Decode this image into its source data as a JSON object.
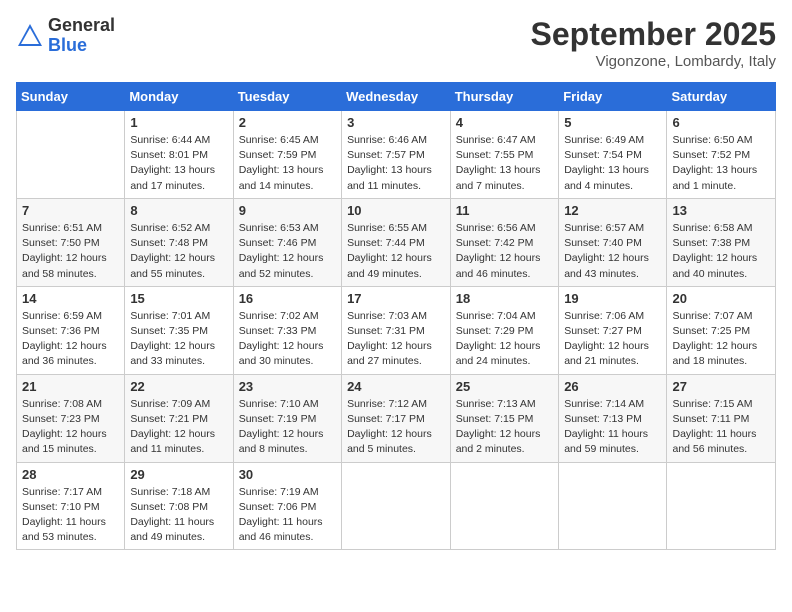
{
  "header": {
    "logo": {
      "general": "General",
      "blue": "Blue"
    },
    "title": "September 2025",
    "subtitle": "Vigonzone, Lombardy, Italy"
  },
  "days_of_week": [
    "Sunday",
    "Monday",
    "Tuesday",
    "Wednesday",
    "Thursday",
    "Friday",
    "Saturday"
  ],
  "weeks": [
    [
      {
        "day": "",
        "sunrise": "",
        "sunset": "",
        "daylight": ""
      },
      {
        "day": "1",
        "sunrise": "Sunrise: 6:44 AM",
        "sunset": "Sunset: 8:01 PM",
        "daylight": "Daylight: 13 hours and 17 minutes."
      },
      {
        "day": "2",
        "sunrise": "Sunrise: 6:45 AM",
        "sunset": "Sunset: 7:59 PM",
        "daylight": "Daylight: 13 hours and 14 minutes."
      },
      {
        "day": "3",
        "sunrise": "Sunrise: 6:46 AM",
        "sunset": "Sunset: 7:57 PM",
        "daylight": "Daylight: 13 hours and 11 minutes."
      },
      {
        "day": "4",
        "sunrise": "Sunrise: 6:47 AM",
        "sunset": "Sunset: 7:55 PM",
        "daylight": "Daylight: 13 hours and 7 minutes."
      },
      {
        "day": "5",
        "sunrise": "Sunrise: 6:49 AM",
        "sunset": "Sunset: 7:54 PM",
        "daylight": "Daylight: 13 hours and 4 minutes."
      },
      {
        "day": "6",
        "sunrise": "Sunrise: 6:50 AM",
        "sunset": "Sunset: 7:52 PM",
        "daylight": "Daylight: 13 hours and 1 minute."
      }
    ],
    [
      {
        "day": "7",
        "sunrise": "Sunrise: 6:51 AM",
        "sunset": "Sunset: 7:50 PM",
        "daylight": "Daylight: 12 hours and 58 minutes."
      },
      {
        "day": "8",
        "sunrise": "Sunrise: 6:52 AM",
        "sunset": "Sunset: 7:48 PM",
        "daylight": "Daylight: 12 hours and 55 minutes."
      },
      {
        "day": "9",
        "sunrise": "Sunrise: 6:53 AM",
        "sunset": "Sunset: 7:46 PM",
        "daylight": "Daylight: 12 hours and 52 minutes."
      },
      {
        "day": "10",
        "sunrise": "Sunrise: 6:55 AM",
        "sunset": "Sunset: 7:44 PM",
        "daylight": "Daylight: 12 hours and 49 minutes."
      },
      {
        "day": "11",
        "sunrise": "Sunrise: 6:56 AM",
        "sunset": "Sunset: 7:42 PM",
        "daylight": "Daylight: 12 hours and 46 minutes."
      },
      {
        "day": "12",
        "sunrise": "Sunrise: 6:57 AM",
        "sunset": "Sunset: 7:40 PM",
        "daylight": "Daylight: 12 hours and 43 minutes."
      },
      {
        "day": "13",
        "sunrise": "Sunrise: 6:58 AM",
        "sunset": "Sunset: 7:38 PM",
        "daylight": "Daylight: 12 hours and 40 minutes."
      }
    ],
    [
      {
        "day": "14",
        "sunrise": "Sunrise: 6:59 AM",
        "sunset": "Sunset: 7:36 PM",
        "daylight": "Daylight: 12 hours and 36 minutes."
      },
      {
        "day": "15",
        "sunrise": "Sunrise: 7:01 AM",
        "sunset": "Sunset: 7:35 PM",
        "daylight": "Daylight: 12 hours and 33 minutes."
      },
      {
        "day": "16",
        "sunrise": "Sunrise: 7:02 AM",
        "sunset": "Sunset: 7:33 PM",
        "daylight": "Daylight: 12 hours and 30 minutes."
      },
      {
        "day": "17",
        "sunrise": "Sunrise: 7:03 AM",
        "sunset": "Sunset: 7:31 PM",
        "daylight": "Daylight: 12 hours and 27 minutes."
      },
      {
        "day": "18",
        "sunrise": "Sunrise: 7:04 AM",
        "sunset": "Sunset: 7:29 PM",
        "daylight": "Daylight: 12 hours and 24 minutes."
      },
      {
        "day": "19",
        "sunrise": "Sunrise: 7:06 AM",
        "sunset": "Sunset: 7:27 PM",
        "daylight": "Daylight: 12 hours and 21 minutes."
      },
      {
        "day": "20",
        "sunrise": "Sunrise: 7:07 AM",
        "sunset": "Sunset: 7:25 PM",
        "daylight": "Daylight: 12 hours and 18 minutes."
      }
    ],
    [
      {
        "day": "21",
        "sunrise": "Sunrise: 7:08 AM",
        "sunset": "Sunset: 7:23 PM",
        "daylight": "Daylight: 12 hours and 15 minutes."
      },
      {
        "day": "22",
        "sunrise": "Sunrise: 7:09 AM",
        "sunset": "Sunset: 7:21 PM",
        "daylight": "Daylight: 12 hours and 11 minutes."
      },
      {
        "day": "23",
        "sunrise": "Sunrise: 7:10 AM",
        "sunset": "Sunset: 7:19 PM",
        "daylight": "Daylight: 12 hours and 8 minutes."
      },
      {
        "day": "24",
        "sunrise": "Sunrise: 7:12 AM",
        "sunset": "Sunset: 7:17 PM",
        "daylight": "Daylight: 12 hours and 5 minutes."
      },
      {
        "day": "25",
        "sunrise": "Sunrise: 7:13 AM",
        "sunset": "Sunset: 7:15 PM",
        "daylight": "Daylight: 12 hours and 2 minutes."
      },
      {
        "day": "26",
        "sunrise": "Sunrise: 7:14 AM",
        "sunset": "Sunset: 7:13 PM",
        "daylight": "Daylight: 11 hours and 59 minutes."
      },
      {
        "day": "27",
        "sunrise": "Sunrise: 7:15 AM",
        "sunset": "Sunset: 7:11 PM",
        "daylight": "Daylight: 11 hours and 56 minutes."
      }
    ],
    [
      {
        "day": "28",
        "sunrise": "Sunrise: 7:17 AM",
        "sunset": "Sunset: 7:10 PM",
        "daylight": "Daylight: 11 hours and 53 minutes."
      },
      {
        "day": "29",
        "sunrise": "Sunrise: 7:18 AM",
        "sunset": "Sunset: 7:08 PM",
        "daylight": "Daylight: 11 hours and 49 minutes."
      },
      {
        "day": "30",
        "sunrise": "Sunrise: 7:19 AM",
        "sunset": "Sunset: 7:06 PM",
        "daylight": "Daylight: 11 hours and 46 minutes."
      },
      {
        "day": "",
        "sunrise": "",
        "sunset": "",
        "daylight": ""
      },
      {
        "day": "",
        "sunrise": "",
        "sunset": "",
        "daylight": ""
      },
      {
        "day": "",
        "sunrise": "",
        "sunset": "",
        "daylight": ""
      },
      {
        "day": "",
        "sunrise": "",
        "sunset": "",
        "daylight": ""
      }
    ]
  ]
}
